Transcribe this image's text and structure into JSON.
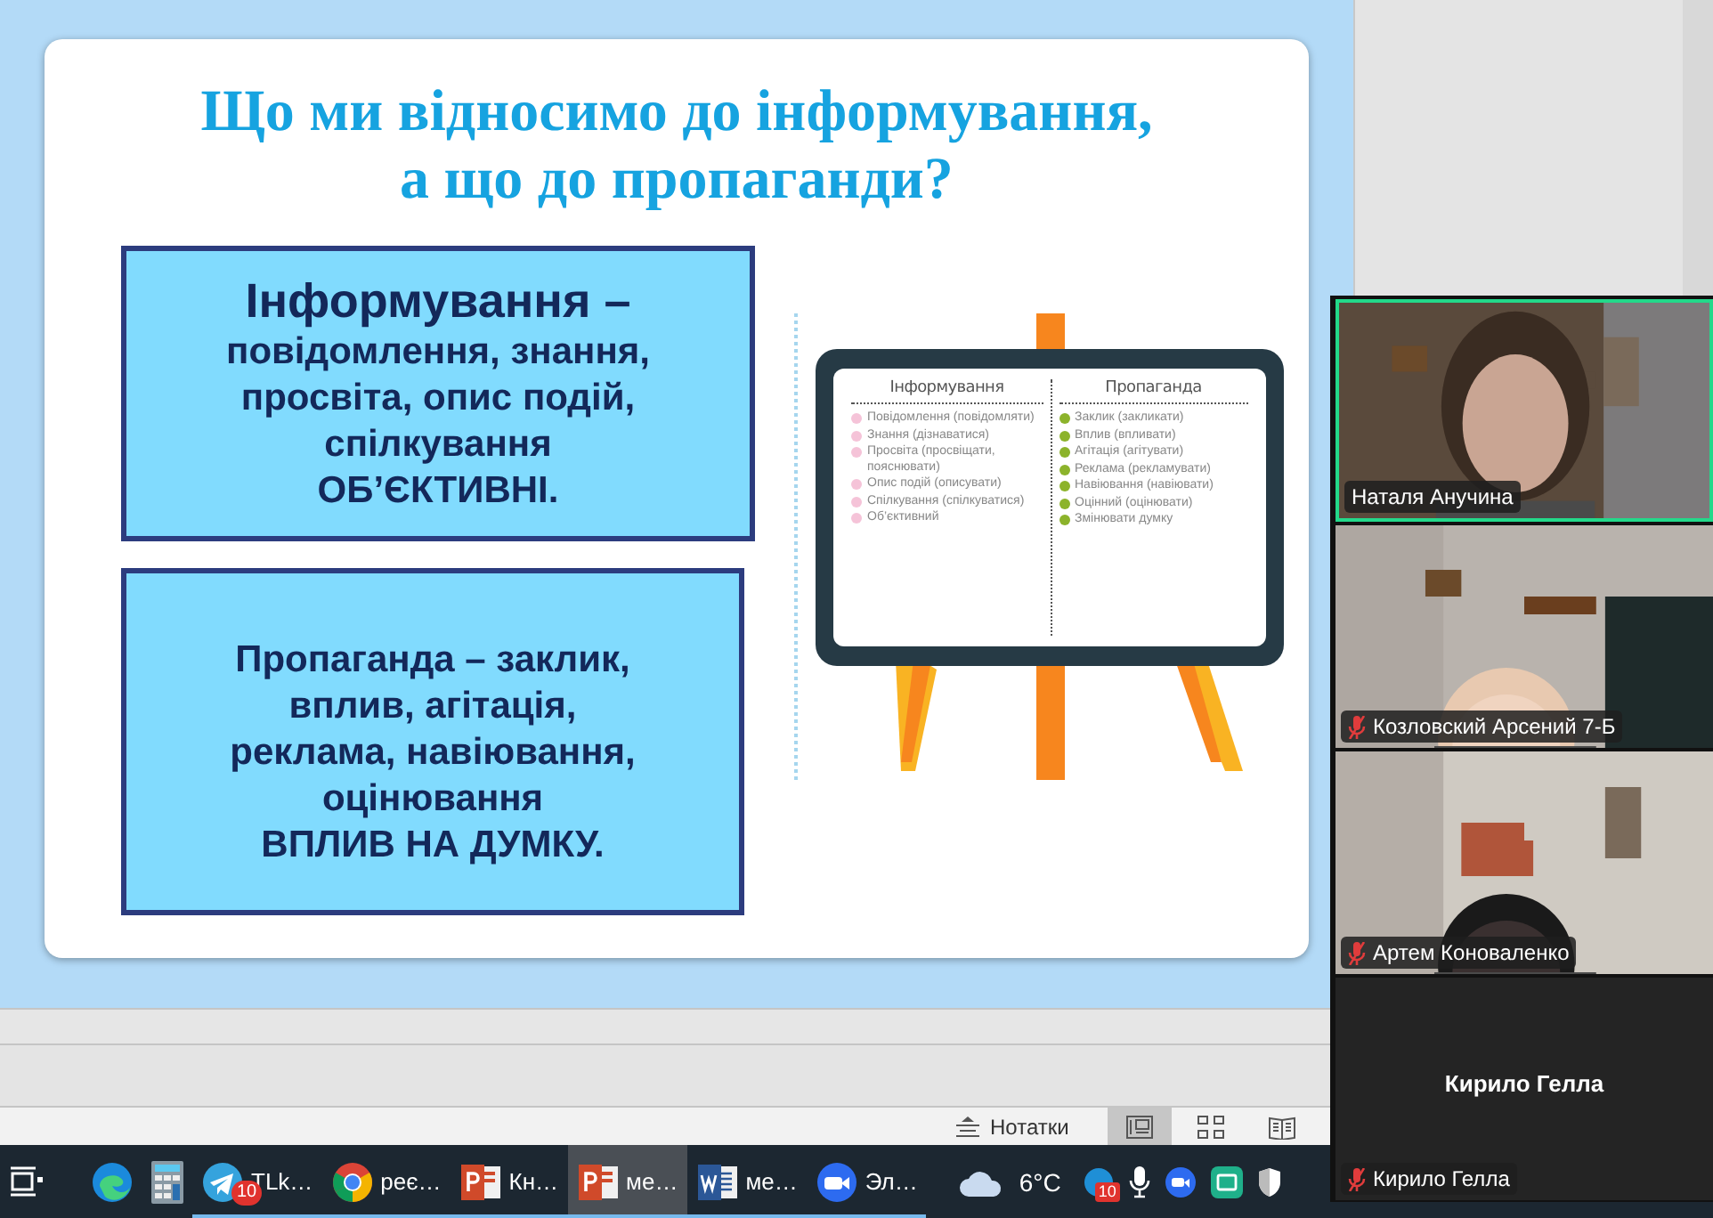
{
  "slide": {
    "title_lines": [
      "Що ми відносимо до інформування,",
      "а що до пропаганди?"
    ],
    "boxes": [
      {
        "lines": [
          {
            "text": "Інформування –",
            "kind": "heading"
          },
          {
            "text": "повідомлення, знання,",
            "kind": "body"
          },
          {
            "text": "просвіта, опис подій,",
            "kind": "body"
          },
          {
            "text": "спілкування",
            "kind": "body"
          },
          {
            "text": "ОБ’ЄКТИВНІ.",
            "kind": "body"
          }
        ]
      },
      {
        "lines": [
          {
            "text": "Пропаганда – заклик,",
            "kind": "body"
          },
          {
            "text": "вплив, агітація,",
            "kind": "body"
          },
          {
            "text": "реклама, навіювання,",
            "kind": "body"
          },
          {
            "text": "оцінювання",
            "kind": "body"
          },
          {
            "text": "ВПЛИВ НА ДУМКУ.",
            "kind": "body"
          }
        ]
      }
    ],
    "board": {
      "columns": [
        {
          "heading": "Інформування",
          "color": "#f5c3d8",
          "items": [
            "Повідомлення (повідомляти)",
            "Знання (дізнаватися)",
            "Просвіта (просвіщати, пояснювати)",
            "Опис подій (описувати)",
            "Спілкування (спілкуватися)",
            "Об’єктивний"
          ]
        },
        {
          "heading": "Пропаганда",
          "color": "#8cb32b",
          "items": [
            "Заклик (закликати)",
            "Вплив (впливати)",
            "Агітація (агітувати)",
            "Реклама (рекламувати)",
            "Навіювання (навіювати)",
            "Оцінний (оцінювати)",
            "Змінювати думку"
          ]
        }
      ]
    }
  },
  "status_bar": {
    "notes_label": "Нотатки",
    "views": [
      {
        "kind": "normal",
        "selected": true
      },
      {
        "kind": "sorter",
        "selected": false
      },
      {
        "kind": "reading",
        "selected": false
      }
    ]
  },
  "taskbar": {
    "apps": [
      {
        "kind": "taskview",
        "open": false,
        "selected": false
      },
      {
        "kind": "edge",
        "open": false,
        "selected": false
      },
      {
        "kind": "calculator",
        "open": false,
        "selected": false
      },
      {
        "kind": "telegram",
        "label": "TLk…",
        "badge": "10",
        "open": true,
        "selected": false
      },
      {
        "kind": "chrome",
        "label": "реє…",
        "open": true,
        "selected": false
      },
      {
        "kind": "powerpoint",
        "label": "Кн…",
        "open": true,
        "selected": false
      },
      {
        "kind": "powerpoint",
        "label": "ме…",
        "open": true,
        "selected": true
      },
      {
        "kind": "word",
        "label": "ме…",
        "open": true,
        "selected": false
      },
      {
        "kind": "zoom",
        "label": "Эл…",
        "open": true,
        "selected": false
      }
    ],
    "weather": {
      "temperature": "6°C"
    },
    "tray": [
      {
        "kind": "circle",
        "badge": "10"
      },
      {
        "kind": "mic"
      },
      {
        "kind": "zoom"
      },
      {
        "kind": "green"
      },
      {
        "kind": "shield"
      }
    ]
  },
  "meeting": {
    "participants": [
      {
        "name": "Наталя Анучина",
        "kind": "video",
        "muted": false,
        "speaking": true
      },
      {
        "name": "Козловский Арсений 7-Б",
        "kind": "video",
        "muted": true,
        "speaking": false
      },
      {
        "name": "Артем Коноваленко",
        "kind": "video",
        "muted": true,
        "speaking": false
      },
      {
        "name": "Кирило Гелла",
        "display_name": "Кирило Гелла",
        "kind": "no_video",
        "muted": true,
        "speaking": false
      }
    ]
  }
}
